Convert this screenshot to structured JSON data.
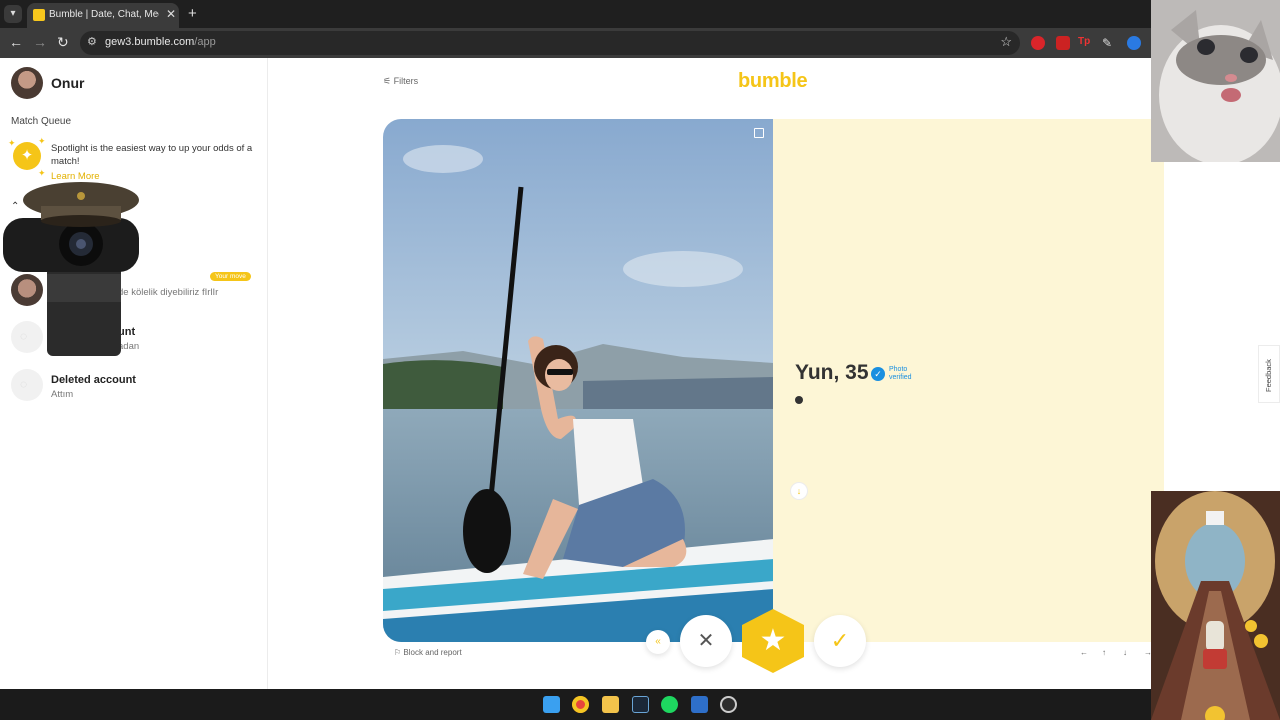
{
  "browser": {
    "tab_title": "Bumble | Date, Chat, Meet New",
    "url_host": "gew3.bumble.com",
    "url_path": "/app"
  },
  "sidebar": {
    "username": "Onur",
    "match_queue_label": "Match Queue",
    "spotlight_text": "Spotlight is the easiest way to up your odds of a match!",
    "learn_more": "Learn More",
    "conversations": [
      {
        "name": "",
        "message": "de kölelik diyebiliriz fIrlIr",
        "badge": "Your move"
      },
      {
        "name": "unt",
        "message": "adan"
      },
      {
        "name": "Deleted account",
        "message": "Attım"
      }
    ]
  },
  "main": {
    "filters_label": "Filters",
    "logo": "bumble",
    "profile": {
      "name_age": "Yun, 35",
      "verified_label": "Photo verified"
    },
    "block_report": "Block and report"
  },
  "feedback_label": "Feedback",
  "colors": {
    "brand": "#f5c518",
    "card_bg": "#fdf6d6",
    "verified": "#1a8fe0"
  }
}
